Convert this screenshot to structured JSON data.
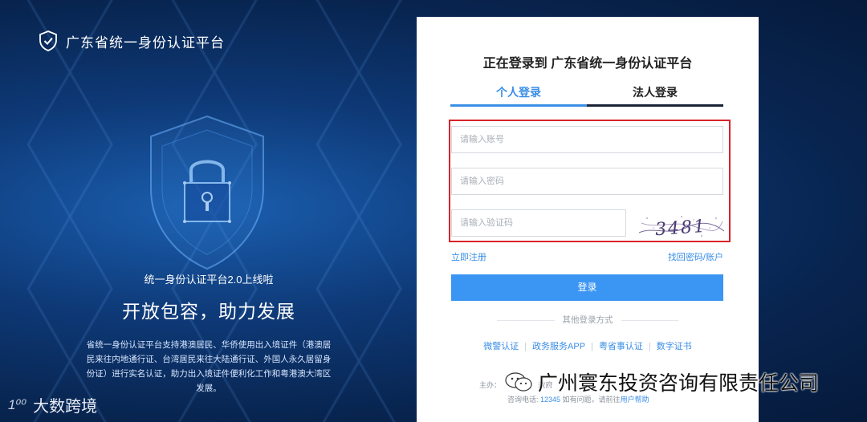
{
  "brand": {
    "name": "广东省统一身份认证平台"
  },
  "promo": {
    "subtitle": "统一身份认证平台2.0上线啦",
    "headline": "开放包容，助力发展",
    "description": "省统一身份认证平台支持港澳居民、华侨使用出入境证件（港澳居民来往内地通行证、台湾居民来往大陆通行证、外国人永久居留身份证）进行实名认证，助力出入境证件便利化工作和粤港澳大湾区发展。"
  },
  "login": {
    "title": "正在登录到 广东省统一身份认证平台",
    "tabs": [
      {
        "label": "个人登录"
      },
      {
        "label": "法人登录"
      }
    ],
    "account_placeholder": "请输入账号",
    "password_placeholder": "请输入密码",
    "captcha_placeholder": "请输入验证码",
    "captcha_text": "3481",
    "register_label": "立即注册",
    "recover_label": "找回密码/账户",
    "login_button": "登录",
    "other_title": "其他登录方式",
    "other_methods": [
      {
        "label": "微警认证"
      },
      {
        "label": "政务服务APP"
      },
      {
        "label": "粤省事认证"
      },
      {
        "label": "数字证书"
      }
    ],
    "footer_line1": "主办：",
    "footer_line1_tail": "政府",
    "footer_prefix": "咨询电话: ",
    "footer_phone": "12345",
    "footer_mid": " 如有问题，请前往",
    "footer_help": "用户帮助"
  },
  "watermarks": {
    "left_mark": "1⁰⁰",
    "left_text": "大数跨境",
    "right_text": "广州寰东投资咨询有限责任公司"
  },
  "colors": {
    "accent": "#3a8ee6",
    "highlight_box": "#d9232a",
    "background": "#0e3a78"
  }
}
